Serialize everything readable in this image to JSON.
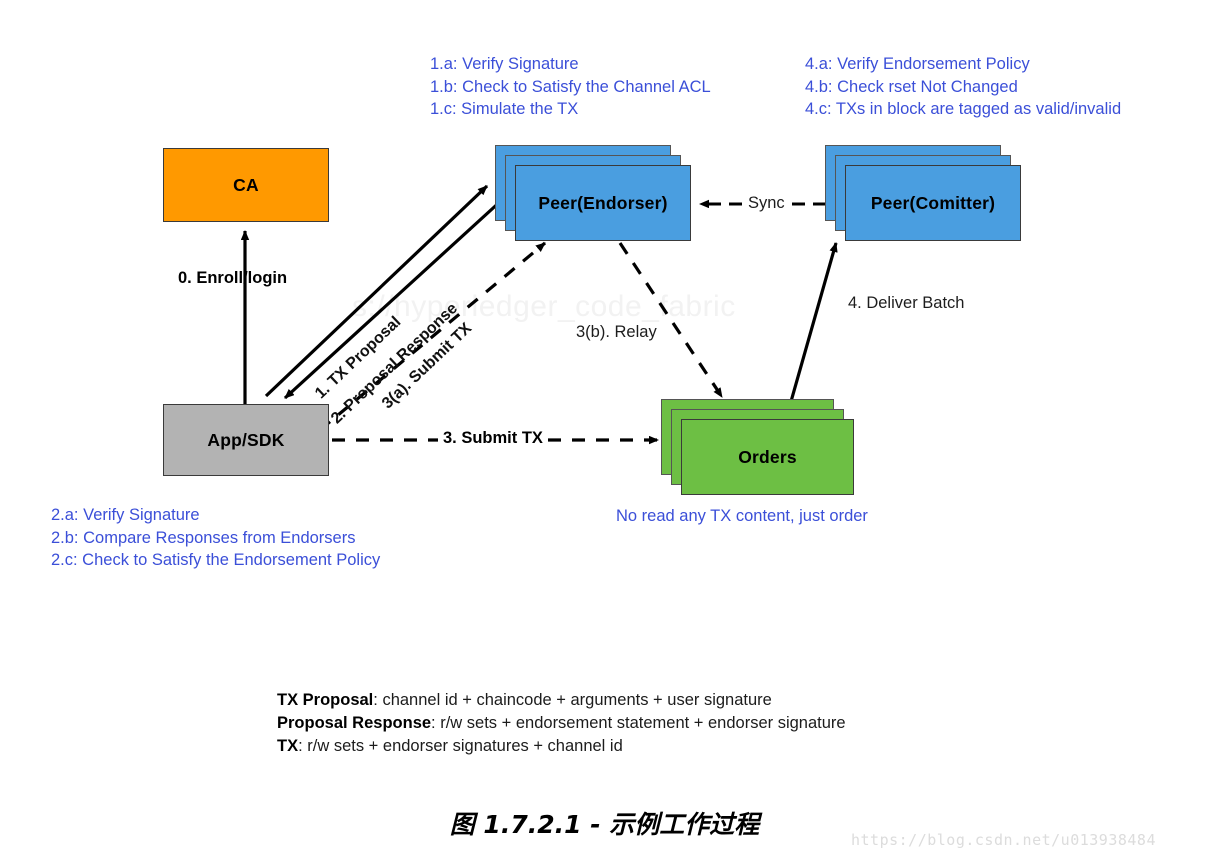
{
  "figure": {
    "caption": "图 1.7.2.1 - 示例工作过程",
    "watermark_url": "https://blog.csdn.net/u013938484",
    "watermark_faint": "s://hyperledger_code_fabric"
  },
  "colors": {
    "note_blue": "#3b4fd8",
    "ca_orange": "#FF9900",
    "peer_blue": "#4a9ee0",
    "orders_green": "#6DBF44",
    "appsdk_gray": "#B3B3B3",
    "stroke": "#3a3a3a"
  },
  "nodes": {
    "ca": {
      "label": "CA"
    },
    "peer_endorser": {
      "label": "Peer(Endorser)"
    },
    "peer_comitter": {
      "label": "Peer(Comitter)"
    },
    "orders": {
      "label": "Orders"
    },
    "app_sdk": {
      "label": "App/SDK"
    }
  },
  "notes": {
    "endorser": {
      "line1": "1.a: Verify Signature",
      "line2": "1.b: Check to Satisfy the Channel ACL",
      "line3": "1.c: Simulate the TX"
    },
    "comitter": {
      "line1": "4.a: Verify Endorsement Policy",
      "line2": "4.b: Check rset Not Changed",
      "line3": "4.c: TXs in block are tagged as valid/invalid"
    },
    "app": {
      "line1": "2.a: Verify Signature",
      "line2": "2.b: Compare Responses from Endorsers",
      "line3": "2.c: Check to Satisfy the Endorsement Policy"
    },
    "orders": {
      "line1": "No read any TX content, just order"
    }
  },
  "edges": {
    "enroll": "0. Enroll/login",
    "tx_proposal": "1. TX Proposal",
    "proposal_response": "2. Proposal Response",
    "submit_tx_a": "3(a). Submit TX",
    "submit_tx": "3. Submit TX",
    "relay": "3(b). Relay",
    "sync": "Sync",
    "deliver_batch": "4. Deliver Batch"
  },
  "legend": {
    "row1": {
      "term": "TX Proposal",
      "desc": ": channel id + chaincode + arguments + user signature"
    },
    "row2": {
      "term": "Proposal Response",
      "desc": ": r/w sets + endorsement statement + endorser signature"
    },
    "row3": {
      "term": "TX",
      "desc": ": r/w sets + endorser signatures + channel id"
    }
  }
}
